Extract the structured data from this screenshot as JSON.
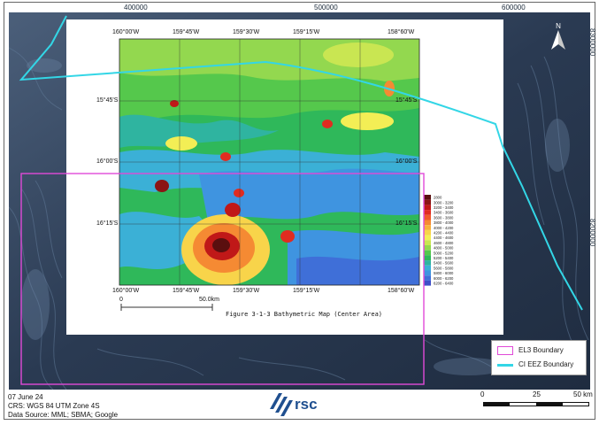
{
  "map": {
    "top_grid_labels": [
      "400000",
      "500000",
      "600000"
    ],
    "right_grid_labels": [
      "8300000",
      "8200000"
    ]
  },
  "figure": {
    "top_longitudes": [
      "160°00'W",
      "159°45'W",
      "159°30'W",
      "159°15'W",
      "158°60'W"
    ],
    "bottom_longitudes": [
      "160°00'W",
      "159°45'W",
      "159°30'W",
      "159°15'W",
      "158°60'W"
    ],
    "left_latitudes": [
      "15°45'S",
      "16°00'S",
      "16°15'S"
    ],
    "right_latitudes": [
      "15°45'S",
      "16°00'S",
      "16°15'S"
    ],
    "caption": "Figure 3-1-3 Bathymetric Map (Center Area)",
    "inner_scale": {
      "start": "0",
      "end": "50.0km"
    },
    "depth_legend": [
      "2800",
      "3000 - 3200",
      "3200 - 3400",
      "3400 - 3600",
      "3600 - 3800",
      "3800 - 4000",
      "4000 - 4200",
      "4200 - 4400",
      "4400 - 4600",
      "4600 - 4800",
      "4800 - 5000",
      "5000 - 5200",
      "5200 - 5400",
      "5400 - 5600",
      "5600 - 5800",
      "5800 - 6000",
      "6000 - 6200",
      "6200 - 6400"
    ],
    "depth_colors": [
      "#5a0f0f",
      "#8b1515",
      "#c01818",
      "#e02c20",
      "#f05a2a",
      "#f58a33",
      "#f7b23c",
      "#f8d44a",
      "#f3ee55",
      "#c9e652",
      "#93d84f",
      "#55c84c",
      "#2fb85a",
      "#2fb4a0",
      "#3bb0d6",
      "#3f94e0",
      "#3f6fd8",
      "#3f4fc8"
    ]
  },
  "legend": {
    "el3": {
      "label": "EL3 Boundary",
      "color": "#e04ad8"
    },
    "eez": {
      "label": "CI EEZ Boundary",
      "color": "#33d6e6"
    }
  },
  "footer": {
    "date": "07 June 24",
    "crs": "CRS: WGS 84 UTM Zone 4S",
    "source": "Data Source: MML; SBMA; Google"
  },
  "north_label": "N",
  "scale": {
    "labels": [
      "0",
      "25",
      "50 km"
    ]
  },
  "brand": {
    "name": "rsc",
    "color": "#1f4f8f"
  }
}
